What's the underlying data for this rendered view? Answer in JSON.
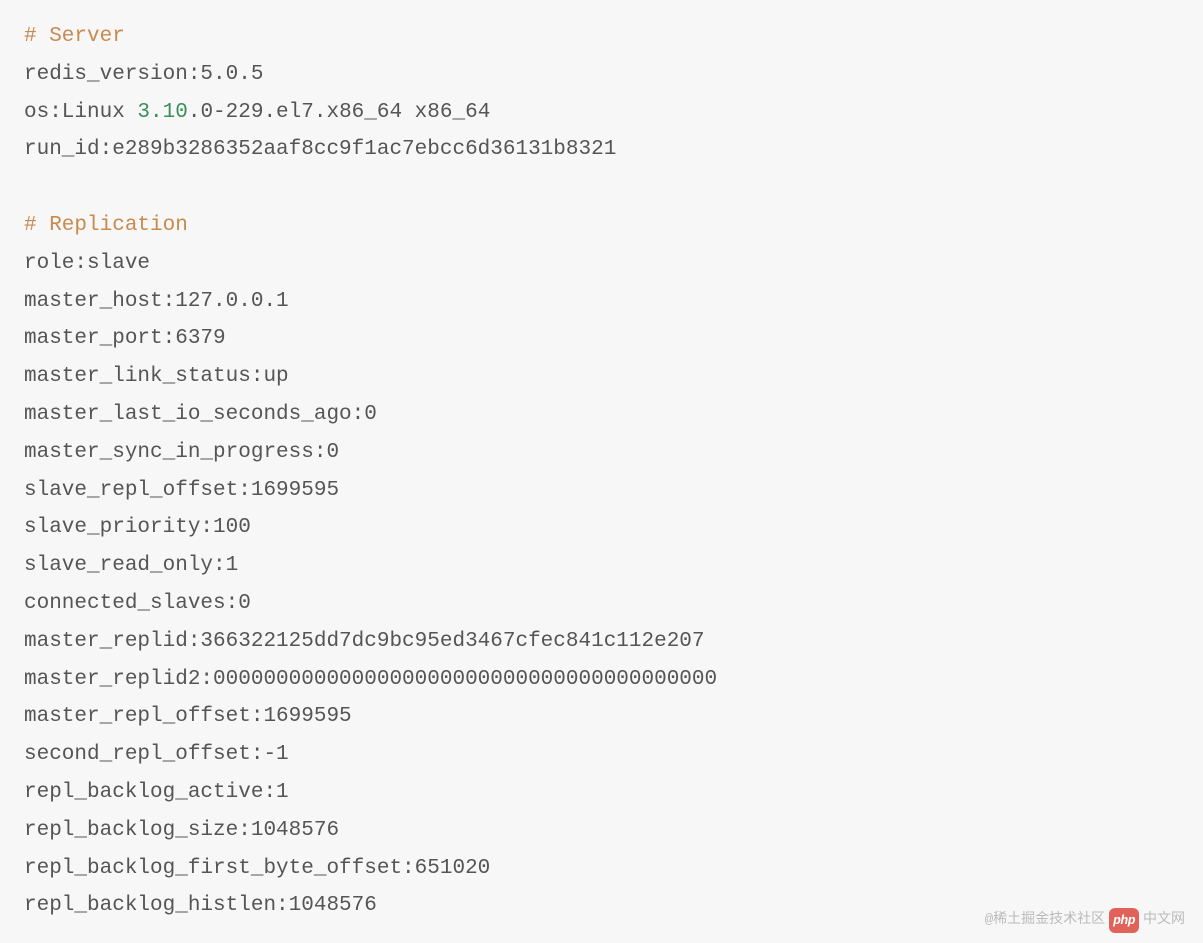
{
  "server": {
    "header": "# Server",
    "lines": {
      "redis_version": "redis_version:5.0.5",
      "os_prefix": "os:Linux ",
      "os_num": "3.10",
      "os_suffix": ".0-229.el7.x86_64 x86_64",
      "run_id": "run_id:e289b3286352aaf8cc9f1ac7ebcc6d36131b8321"
    }
  },
  "replication": {
    "header": "# Replication",
    "lines": {
      "role": "role:slave",
      "master_host": "master_host:127.0.0.1",
      "master_port": "master_port:6379",
      "master_link_status": "master_link_status:up",
      "master_last_io_seconds_ago": "master_last_io_seconds_ago:0",
      "master_sync_in_progress": "master_sync_in_progress:0",
      "slave_repl_offset": "slave_repl_offset:1699595",
      "slave_priority": "slave_priority:100",
      "slave_read_only": "slave_read_only:1",
      "connected_slaves": "connected_slaves:0",
      "master_replid": "master_replid:366322125dd7dc9bc95ed3467cfec841c112e207",
      "master_replid2": "master_replid2:0000000000000000000000000000000000000000",
      "master_repl_offset": "master_repl_offset:1699595",
      "second_repl_offset": "second_repl_offset:-1",
      "repl_backlog_active": "repl_backlog_active:1",
      "repl_backlog_size": "repl_backlog_size:1048576",
      "repl_backlog_first_byte_offset": "repl_backlog_first_byte_offset:651020",
      "repl_backlog_histlen": "repl_backlog_histlen:1048576"
    }
  },
  "watermark": {
    "text_left": "@稀土掘金技术社区",
    "logo": "php",
    "text_right": "中文网"
  }
}
